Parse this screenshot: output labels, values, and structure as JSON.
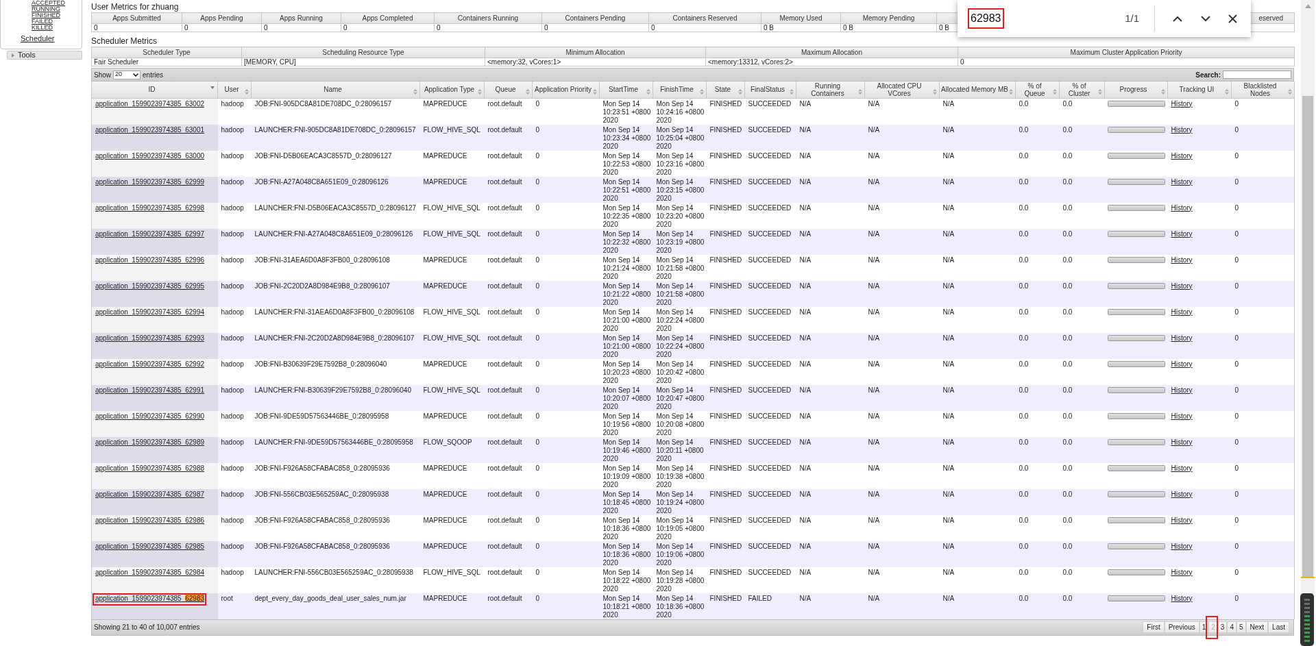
{
  "sidebar": {
    "app_links": [
      {
        "label": "ACCEPTED"
      },
      {
        "label": "RUNNING"
      },
      {
        "label": "FINISHED"
      },
      {
        "label": "FAILED"
      },
      {
        "label": "KILLED"
      }
    ],
    "scheduler_link": "Scheduler",
    "sections": [
      {
        "label": "Tools",
        "expanded": false
      }
    ]
  },
  "user_metrics": {
    "title": "User Metrics for zhuang",
    "columns": [
      {
        "label": "Apps Submitted",
        "value": "0"
      },
      {
        "label": "Apps Pending",
        "value": "0"
      },
      {
        "label": "Apps Running",
        "value": "0"
      },
      {
        "label": "Apps Completed",
        "value": "0"
      },
      {
        "label": "Containers Running",
        "value": "0"
      },
      {
        "label": "Containers Pending",
        "value": "0"
      },
      {
        "label": "Containers Reserved",
        "value": "0"
      },
      {
        "label": "Memory Used",
        "value": "0 B"
      },
      {
        "label": "Memory Pending",
        "value": "0 B"
      },
      {
        "value": "0 B"
      },
      {},
      {
        "label": "eserved"
      }
    ]
  },
  "scheduler_metrics": {
    "title": "Scheduler Metrics",
    "columns": [
      {
        "label": "Scheduler Type",
        "value": "Fair Scheduler"
      },
      {
        "label": "Scheduling Resource Type",
        "value": "[MEMORY, CPU]"
      },
      {
        "label": "Minimum Allocation",
        "value": "<memory:32, vCores:1>"
      },
      {
        "label": "Maximum Allocation",
        "value": "<memory:13312, vCores:2>"
      },
      {
        "label": "Maximum Cluster Application Priority",
        "value": "0"
      }
    ]
  },
  "apps_table": {
    "show_label": "Show",
    "page_size": "20",
    "entries_label": "entries",
    "search_label": "Search:",
    "columns": [
      {
        "label": "ID",
        "sorted": true
      },
      {
        "label": "User",
        "sorted": false
      },
      {
        "label": "Name",
        "sorted": false
      },
      {
        "label": "Application Type",
        "sorted": false
      },
      {
        "label": "Queue",
        "sorted": false
      },
      {
        "label": "Application Priority",
        "sorted": false
      },
      {
        "label": "StartTime",
        "sorted": false
      },
      {
        "label": "FinishTime",
        "sorted": false
      },
      {
        "label": "State",
        "sorted": false
      },
      {
        "label": "FinalStatus",
        "sorted": false
      },
      {
        "label": "Running Containers",
        "sorted": false
      },
      {
        "label": "Allocated CPU VCores",
        "sorted": false
      },
      {
        "label": "Allocated Memory MB",
        "sorted": false
      },
      {
        "label": "% of Queue",
        "sorted": false
      },
      {
        "label": "% of Cluster",
        "sorted": false
      },
      {
        "label": "Progress",
        "sorted": false
      },
      {
        "label": "Tracking UI",
        "sorted": false
      },
      {
        "label": "Blacklisted Nodes",
        "sorted": false
      }
    ],
    "rows": [
      {
        "id": "application_1599023974385_63002",
        "user": "hadoop",
        "name": "JOB:FNI-905DC8A81DE708DC_0:28096157",
        "type": "MAPREDUCE",
        "queue": "root.default",
        "priority": "0",
        "start": "Mon Sep 14 10:23:51 +0800 2020",
        "finish": "Mon Sep 14 10:24:16 +0800 2020",
        "state": "FINISHED",
        "final": "SUCCEEDED",
        "running": "N/A",
        "cpu": "N/A",
        "mem": "N/A",
        "pq": "0.0",
        "pc": "0.0",
        "tracking": "History",
        "blacklisted": "0",
        "annotated": false,
        "level": 1
      },
      {
        "id": "application_1599023974385_63001",
        "user": "hadoop",
        "name": "LAUNCHER:FNI-905DC8A81DE708DC_0:28096157",
        "type": "FLOW_HIVE_SQL",
        "queue": "root.default",
        "priority": "0",
        "start": "Mon Sep 14 10:23:34 +0800 2020",
        "finish": "Mon Sep 14 10:25:04 +0800 2020",
        "state": "FINISHED",
        "final": "SUCCEEDED",
        "running": "N/A",
        "cpu": "N/A",
        "mem": "N/A",
        "pq": "0.0",
        "pc": "0.0",
        "tracking": "History",
        "blacklisted": "0",
        "annotated": false,
        "level": 1
      },
      {
        "id": "application_1599023974385_63000",
        "user": "hadoop",
        "name": "JOB:FNI-D5B06EACA3C8557D_0:28096127",
        "type": "MAPREDUCE",
        "queue": "root.default",
        "priority": "0",
        "start": "Mon Sep 14 10:22:53 +0800 2020",
        "finish": "Mon Sep 14 10:23:16 +0800 2020",
        "state": "FINISHED",
        "final": "SUCCEEDED",
        "running": "N/A",
        "cpu": "N/A",
        "mem": "N/A",
        "pq": "0.0",
        "pc": "0.0",
        "tracking": "History",
        "blacklisted": "0",
        "annotated": false,
        "level": 1
      },
      {
        "id": "application_1599023974385_62999",
        "user": "hadoop",
        "name": "JOB:FNI-A27A048C8A651E09_0:28096126",
        "type": "MAPREDUCE",
        "queue": "root.default",
        "priority": "0",
        "start": "Mon Sep 14 10:22:51 +0800 2020",
        "finish": "Mon Sep 14 10:23:15 +0800 2020",
        "state": "FINISHED",
        "final": "SUCCEEDED",
        "running": "N/A",
        "cpu": "N/A",
        "mem": "N/A",
        "pq": "0.0",
        "pc": "0.0",
        "tracking": "History",
        "blacklisted": "0",
        "annotated": false,
        "level": 1
      },
      {
        "id": "application_1599023974385_62998",
        "user": "hadoop",
        "name": "LAUNCHER:FNI-D5B06EACA3C8557D_0:28096127",
        "type": "FLOW_HIVE_SQL",
        "queue": "root.default",
        "priority": "0",
        "start": "Mon Sep 14 10:22:35 +0800 2020",
        "finish": "Mon Sep 14 10:23:20 +0800 2020",
        "state": "FINISHED",
        "final": "SUCCEEDED",
        "running": "N/A",
        "cpu": "N/A",
        "mem": "N/A",
        "pq": "0.0",
        "pc": "0.0",
        "tracking": "History",
        "blacklisted": "0",
        "annotated": false,
        "level": 1
      },
      {
        "id": "application_1599023974385_62997",
        "user": "hadoop",
        "name": "LAUNCHER:FNI-A27A048C8A651E09_0:28096126",
        "type": "FLOW_HIVE_SQL",
        "queue": "root.default",
        "priority": "0",
        "start": "Mon Sep 14 10:22:32 +0800 2020",
        "finish": "Mon Sep 14 10:23:19 +0800 2020",
        "state": "FINISHED",
        "final": "SUCCEEDED",
        "running": "N/A",
        "cpu": "N/A",
        "mem": "N/A",
        "pq": "0.0",
        "pc": "0.0",
        "tracking": "History",
        "blacklisted": "0",
        "annotated": false,
        "level": 1
      },
      {
        "id": "application_1599023974385_62996",
        "user": "hadoop",
        "name": "JOB:FNI-31AEA6D0A8F3FB00_0:28096108",
        "type": "MAPREDUCE",
        "queue": "root.default",
        "priority": "0",
        "start": "Mon Sep 14 10:21:24 +0800 2020",
        "finish": "Mon Sep 14 10:21:58 +0800 2020",
        "state": "FINISHED",
        "final": "SUCCEEDED",
        "running": "N/A",
        "cpu": "N/A",
        "mem": "N/A",
        "pq": "0.0",
        "pc": "0.0",
        "tracking": "History",
        "blacklisted": "0",
        "annotated": false,
        "level": 1
      },
      {
        "id": "application_1599023974385_62995",
        "user": "hadoop",
        "name": "JOB:FNI-2C20D2A8D984E9B8_0:28096107",
        "type": "MAPREDUCE",
        "queue": "root.default",
        "priority": "0",
        "start": "Mon Sep 14 10:21:22 +0800 2020",
        "finish": "Mon Sep 14 10:21:58 +0800 2020",
        "state": "FINISHED",
        "final": "SUCCEEDED",
        "running": "N/A",
        "cpu": "N/A",
        "mem": "N/A",
        "pq": "0.0",
        "pc": "0.0",
        "tracking": "History",
        "blacklisted": "0",
        "annotated": false,
        "level": 1
      },
      {
        "id": "application_1599023974385_62994",
        "user": "hadoop",
        "name": "LAUNCHER:FNI-31AEA6D0A8F3FB00_0:28096108",
        "type": "FLOW_HIVE_SQL",
        "queue": "root.default",
        "priority": "0",
        "start": "Mon Sep 14 10:21:00 +0800 2020",
        "finish": "Mon Sep 14 10:22:24 +0800 2020",
        "state": "FINISHED",
        "final": "SUCCEEDED",
        "running": "N/A",
        "cpu": "N/A",
        "mem": "N/A",
        "pq": "0.0",
        "pc": "0.0",
        "tracking": "History",
        "blacklisted": "0",
        "annotated": false,
        "level": 1
      },
      {
        "id": "application_1599023974385_62993",
        "user": "hadoop",
        "name": "LAUNCHER:FNI-2C20D2A8D984E9B8_0:28096107",
        "type": "FLOW_HIVE_SQL",
        "queue": "root.default",
        "priority": "0",
        "start": "Mon Sep 14 10:21:00 +0800 2020",
        "finish": "Mon Sep 14 10:22:24 +0800 2020",
        "state": "FINISHED",
        "final": "SUCCEEDED",
        "running": "N/A",
        "cpu": "N/A",
        "mem": "N/A",
        "pq": "0.0",
        "pc": "0.0",
        "tracking": "History",
        "blacklisted": "0",
        "annotated": false,
        "level": 1
      },
      {
        "id": "application_1599023974385_62992",
        "user": "hadoop",
        "name": "JOB:FNI-B30639F29E7592B8_0:28096040",
        "type": "MAPREDUCE",
        "queue": "root.default",
        "priority": "0",
        "start": "Mon Sep 14 10:20:23 +0800 2020",
        "finish": "Mon Sep 14 10:20:42 +0800 2020",
        "state": "FINISHED",
        "final": "SUCCEEDED",
        "running": "N/A",
        "cpu": "N/A",
        "mem": "N/A",
        "pq": "0.0",
        "pc": "0.0",
        "tracking": "History",
        "blacklisted": "0",
        "annotated": false,
        "level": 1
      },
      {
        "id": "application_1599023974385_62991",
        "user": "hadoop",
        "name": "LAUNCHER:FNI-B30639F29E7592B8_0:28096040",
        "type": "FLOW_HIVE_SQL",
        "queue": "root.default",
        "priority": "0",
        "start": "Mon Sep 14 10:20:07 +0800 2020",
        "finish": "Mon Sep 14 10:20:47 +0800 2020",
        "state": "FINISHED",
        "final": "SUCCEEDED",
        "running": "N/A",
        "cpu": "N/A",
        "mem": "N/A",
        "pq": "0.0",
        "pc": "0.0",
        "tracking": "History",
        "blacklisted": "0",
        "annotated": false,
        "level": 1
      },
      {
        "id": "application_1599023974385_62990",
        "user": "hadoop",
        "name": "JOB:FNI-9DE59D57563446BE_0:28095958",
        "type": "MAPREDUCE",
        "queue": "root.default",
        "priority": "0",
        "start": "Mon Sep 14 10:19:56 +0800 2020",
        "finish": "Mon Sep 14 10:20:08 +0800 2020",
        "state": "FINISHED",
        "final": "SUCCEEDED",
        "running": "N/A",
        "cpu": "N/A",
        "mem": "N/A",
        "pq": "0.0",
        "pc": "0.0",
        "tracking": "History",
        "blacklisted": "0",
        "annotated": false,
        "level": 1
      },
      {
        "id": "application_1599023974385_62989",
        "user": "hadoop",
        "name": "LAUNCHER:FNI-9DE59D57563446BE_0:28095958",
        "type": "FLOW_SQOOP",
        "queue": "root.default",
        "priority": "0",
        "start": "Mon Sep 14 10:19:46 +0800 2020",
        "finish": "Mon Sep 14 10:20:11 +0800 2020",
        "state": "FINISHED",
        "final": "SUCCEEDED",
        "running": "N/A",
        "cpu": "N/A",
        "mem": "N/A",
        "pq": "0.0",
        "pc": "0.0",
        "tracking": "History",
        "blacklisted": "0",
        "annotated": false,
        "level": 1
      },
      {
        "id": "application_1599023974385_62988",
        "user": "hadoop",
        "name": "JOB:FNI-F926A58CFABAC858_0:28095936",
        "type": "MAPREDUCE",
        "queue": "root.default",
        "priority": "0",
        "start": "Mon Sep 14 10:19:09 +0800 2020",
        "finish": "Mon Sep 14 10:19:38 +0800 2020",
        "state": "FINISHED",
        "final": "SUCCEEDED",
        "running": "N/A",
        "cpu": "N/A",
        "mem": "N/A",
        "pq": "0.0",
        "pc": "0.0",
        "tracking": "History",
        "blacklisted": "0",
        "annotated": false,
        "level": 1
      },
      {
        "id": "application_1599023974385_62987",
        "user": "hadoop",
        "name": "JOB:FNI-556CB03E565259AC_0:28095938",
        "type": "MAPREDUCE",
        "queue": "root.default",
        "priority": "0",
        "start": "Mon Sep 14 10:18:45 +0800 2020",
        "finish": "Mon Sep 14 10:19:24 +0800 2020",
        "state": "FINISHED",
        "final": "SUCCEEDED",
        "running": "N/A",
        "cpu": "N/A",
        "mem": "N/A",
        "pq": "0.0",
        "pc": "0.0",
        "tracking": "History",
        "blacklisted": "0",
        "annotated": false,
        "level": 1
      },
      {
        "id": "application_1599023974385_62986",
        "user": "hadoop",
        "name": "JOB:FNI-F926A58CFABAC858_0:28095936",
        "type": "MAPREDUCE",
        "queue": "root.default",
        "priority": "0",
        "start": "Mon Sep 14 10:18:36 +0800 2020",
        "finish": "Mon Sep 14 10:19:05 +0800 2020",
        "state": "FINISHED",
        "final": "SUCCEEDED",
        "running": "N/A",
        "cpu": "N/A",
        "mem": "N/A",
        "pq": "0.0",
        "pc": "0.0",
        "tracking": "History",
        "blacklisted": "0",
        "annotated": false,
        "level": 1
      },
      {
        "id": "application_1599023974385_62985",
        "user": "hadoop",
        "name": "JOB:FNI-F926A58CFABAC858_0:28095936",
        "type": "MAPREDUCE",
        "queue": "root.default",
        "priority": "0",
        "start": "Mon Sep 14 10:18:36 +0800 2020",
        "finish": "Mon Sep 14 10:19:06 +0800 2020",
        "state": "FINISHED",
        "final": "SUCCEEDED",
        "running": "N/A",
        "cpu": "N/A",
        "mem": "N/A",
        "pq": "0.0",
        "pc": "0.0",
        "tracking": "History",
        "blacklisted": "0",
        "annotated": false,
        "level": 1
      },
      {
        "id": "application_1599023974385_62984",
        "user": "hadoop",
        "name": "LAUNCHER:FNI-556CB03E565259AC_0:28095938",
        "type": "FLOW_HIVE_SQL",
        "queue": "root.default",
        "priority": "0",
        "start": "Mon Sep 14 10:18:22 +0800 2020",
        "finish": "Mon Sep 14 10:19:28 +0800 2020",
        "state": "FINISHED",
        "final": "SUCCEEDED",
        "running": "N/A",
        "cpu": "N/A",
        "mem": "N/A",
        "pq": "0.0",
        "pc": "0.0",
        "tracking": "History",
        "blacklisted": "0",
        "annotated": false,
        "level": 1
      },
      {
        "id": "application_1599023974385_",
        "match": "62983",
        "user": "root",
        "name": "dept_every_day_goods_deal_user_sales_num.jar",
        "type": "MAPREDUCE",
        "queue": "root.default",
        "priority": "0",
        "start": "Mon Sep 14 10:18:21 +0800 2020",
        "finish": "Mon Sep 14 10:18:36 +0800 2020",
        "state": "FINISHED",
        "final": "FAILED",
        "running": "N/A",
        "cpu": "N/A",
        "mem": "N/A",
        "pq": "0.0",
        "pc": "0.0",
        "tracking": "History",
        "blacklisted": "0",
        "annotated": true,
        "level": 1
      }
    ],
    "info": "Showing 21 to 40 of 10,007 entries",
    "pages": [
      {
        "label": "First",
        "kind": "nav",
        "selected": false,
        "annotated": false
      },
      {
        "label": "Previous",
        "kind": "nav",
        "selected": false,
        "annotated": false
      },
      {
        "label": "1",
        "kind": "page",
        "selected": false,
        "annotated": false
      },
      {
        "label": "2",
        "kind": "page",
        "selected": true,
        "annotated": true
      },
      {
        "label": "3",
        "kind": "page",
        "selected": false,
        "annotated": false
      },
      {
        "label": "4",
        "kind": "page",
        "selected": false,
        "annotated": false
      },
      {
        "label": "5",
        "kind": "page",
        "selected": false,
        "annotated": false
      },
      {
        "label": "Next",
        "kind": "nav",
        "selected": false,
        "annotated": false
      },
      {
        "label": "Last",
        "kind": "nav",
        "selected": false,
        "annotated": false
      }
    ]
  },
  "find_bar": {
    "query": "62983",
    "query_annotated": true,
    "count": "1/1"
  }
}
